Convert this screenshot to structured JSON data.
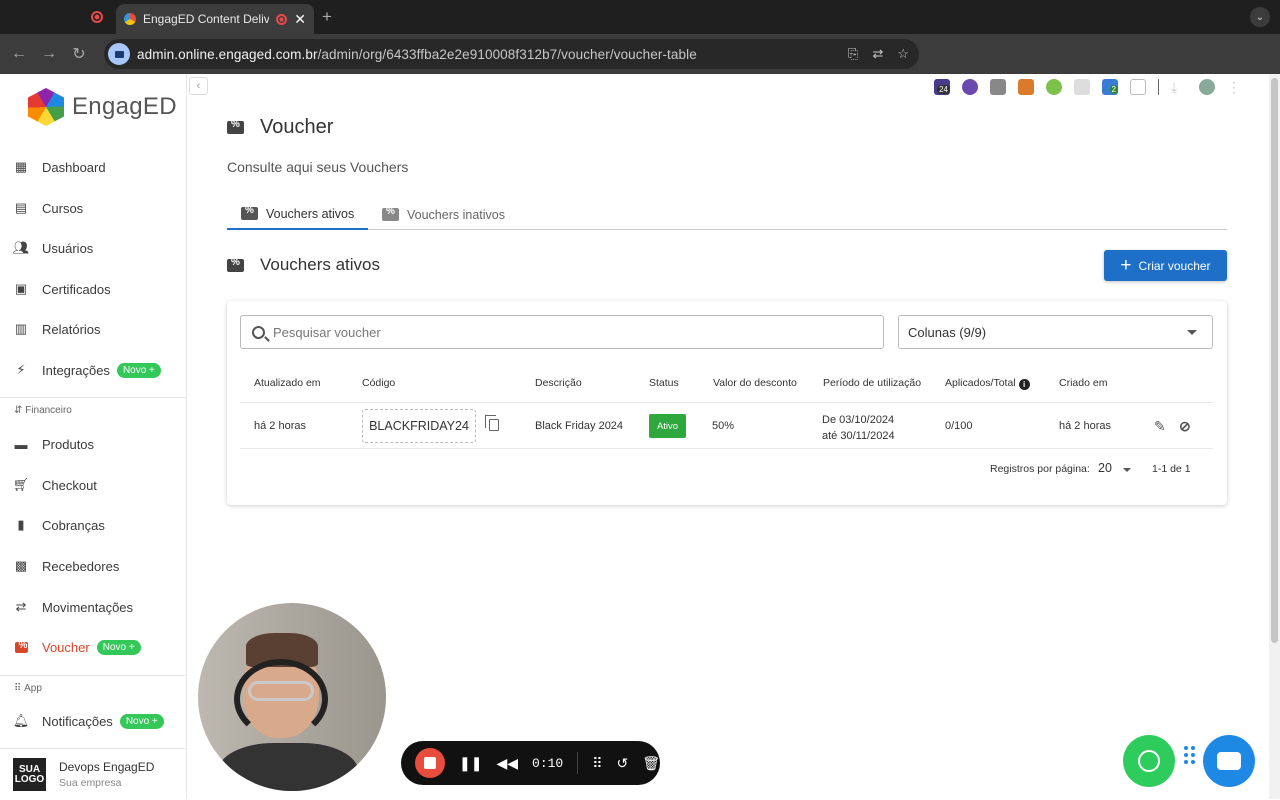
{
  "browser": {
    "active_tab_title": "EngagED Content Delivery",
    "url_host": "admin.online.engaged.com.br",
    "url_path": "/admin/org/6433ffba2e2e910008f312b7/voucher/voucher-table",
    "ext_badge_count": "24",
    "ext_badge_count2": "2"
  },
  "sidebar": {
    "logo": "EngagED",
    "items": [
      {
        "label": "Dashboard",
        "icon": "dashboard-icon"
      },
      {
        "label": "Cursos",
        "icon": "library-icon"
      },
      {
        "label": "Usuários",
        "icon": "people-icon"
      },
      {
        "label": "Certificados",
        "icon": "certificate-icon"
      },
      {
        "label": "Relatórios",
        "icon": "report-icon"
      },
      {
        "label": "Integrações",
        "icon": "plug-icon",
        "badge": "Novo +"
      }
    ],
    "section_financeiro": "Financeiro",
    "fin_items": [
      {
        "label": "Produtos",
        "icon": "product-icon"
      },
      {
        "label": "Checkout",
        "icon": "cart-icon"
      },
      {
        "label": "Cobranças",
        "icon": "invoice-icon"
      },
      {
        "label": "Recebedores",
        "icon": "recipient-icon"
      },
      {
        "label": "Movimentações",
        "icon": "transfer-icon"
      },
      {
        "label": "Voucher",
        "icon": "voucher-icon",
        "badge": "Novo +",
        "active": true
      }
    ],
    "section_app": "App",
    "app_items": [
      {
        "label": "Notificações",
        "icon": "bell-icon",
        "badge": "Novo +"
      }
    ],
    "company": {
      "logo_text": "SUA LOGO",
      "name": "Devops EngagED",
      "subtitle": "Sua empresa"
    }
  },
  "main": {
    "title": "Voucher",
    "subtitle": "Consulte aqui seus Vouchers",
    "tabs": [
      "Vouchers ativos",
      "Vouchers inativos"
    ],
    "section_title": "Vouchers ativos",
    "create_button": "Criar voucher",
    "search_placeholder": "Pesquisar voucher",
    "columns_select": "Colunas (9/9)",
    "table": {
      "headers": [
        "Atualizado em",
        "Código",
        "Descrição",
        "Status",
        "Valor do desconto",
        "Período de utilização",
        "Aplicados/Total",
        "Criado em"
      ],
      "rows": [
        {
          "updated": "há 2 horas",
          "code": "BLACKFRIDAY24",
          "description": "Black Friday 2024",
          "status": "Ativo",
          "discount": "50%",
          "period_from": "De 03/10/2024",
          "period_to": "até 30/11/2024",
          "applied": "0/100",
          "created": "há 2 horas"
        }
      ]
    },
    "footer": {
      "per_page_label": "Registros por página:",
      "per_page": "20",
      "range": "1-1 de 1"
    }
  },
  "recorder": {
    "timer": "0:10"
  },
  "colors": {
    "accent": "#1e6fc8",
    "active_nav": "#d9472b",
    "status_active": "#2ea83c",
    "badge_green": "#34c759",
    "whatsapp": "#2ecc5d"
  }
}
